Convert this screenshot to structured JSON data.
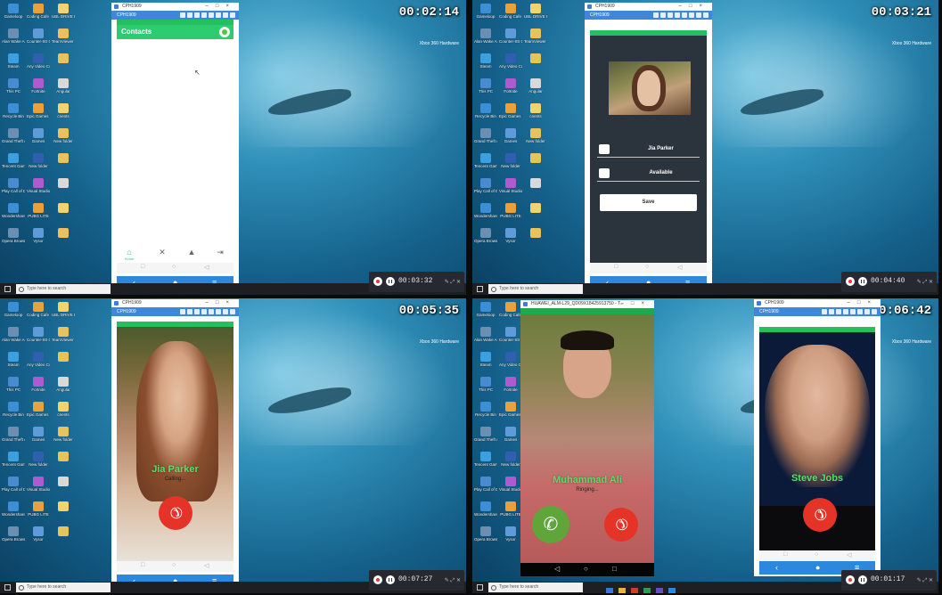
{
  "quadrants": [
    {
      "timestamp": "00:02:14",
      "window_title": "CPH1909",
      "toolbar_label": "CPH1909",
      "screen": "contacts",
      "header_title": "Contacts",
      "tabs": [
        {
          "label": "Home",
          "icon": "home-icon"
        },
        {
          "label": "",
          "icon": "tools-icon"
        },
        {
          "label": "",
          "icon": "bell-icon"
        },
        {
          "label": "",
          "icon": "logout-icon"
        }
      ],
      "recorder_time": "00:03:32"
    },
    {
      "timestamp": "00:03:21",
      "window_title": "CPH1909",
      "toolbar_label": "CPH1909",
      "screen": "profile",
      "name_value": "Jia Parker",
      "status_value": "Available",
      "save_label": "Save",
      "recorder_time": "00:04:40"
    },
    {
      "timestamp": "00:05:35",
      "window_title": "CPH1909",
      "toolbar_label": "CPH1909",
      "screen": "outgoing-call",
      "caller_name": "Jia Parker",
      "call_status": "Calling...",
      "recorder_time": "00:07:27"
    },
    {
      "timestamp": "00:06:42",
      "window_title": "CPH1909",
      "toolbar_label": "CPH1909",
      "screen": "video-call",
      "phone_window_title": "HUAWEI_ALM-L29_QD09X18425913750 - T...",
      "incoming_name": "Muhammad Ali",
      "incoming_status": "Ringing...",
      "outgoing_name": "Steve Jobs",
      "recorder_time": "00:01:17"
    }
  ],
  "taskbar": {
    "search_placeholder": "Type here to search"
  },
  "xbox_label": "Xbox 360 Hardware",
  "desktop_icons": [
    "Gameloop",
    "Coding Cafe Work Space",
    "UBL DRIVE IMPORTANT",
    "Alan Wake American",
    "Counter-Str Global Offe",
    "TeamViewer 14",
    "Steam",
    "Any Video Converter",
    "",
    "This PC",
    "Fortnite",
    "Angular",
    "Recycle Bin",
    "Epic Games Launcher",
    "cnents",
    "Grand Theft Auto V",
    "Games",
    "New folder",
    "Tencent Gamin",
    "New folder",
    "",
    "Play Call of Duty 5",
    "Visual Studio Code",
    "",
    "Wondershare Filmora",
    "PUBG LITE",
    "",
    "Opera Browser",
    "Vysor",
    ""
  ],
  "colors": {
    "accent_green": "#2ecc71",
    "toolbar_blue": "#3f87d8",
    "decline_red": "#e53327",
    "accept_green": "#5fa53a",
    "profile_bg": "#2b333d"
  }
}
